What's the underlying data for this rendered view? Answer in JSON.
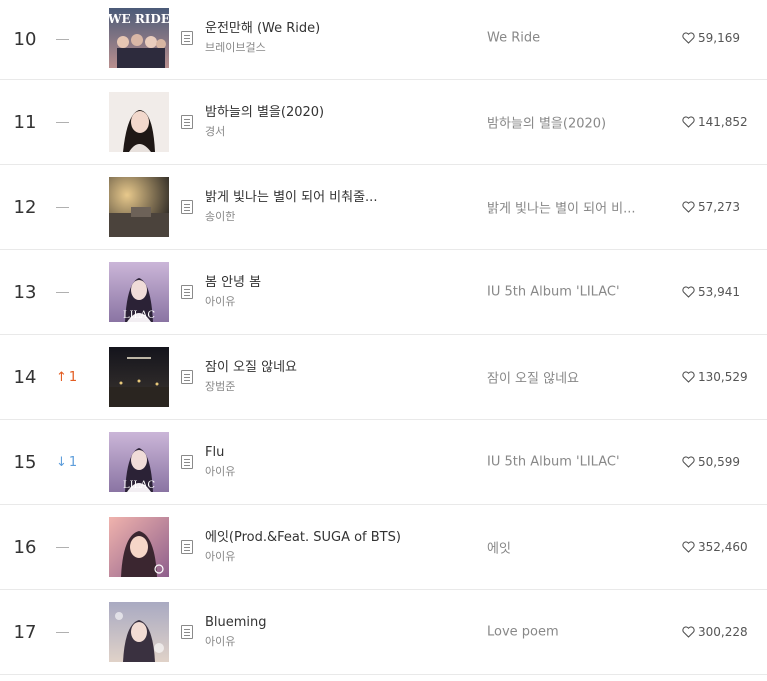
{
  "rows": [
    {
      "rank": "10",
      "change": "same",
      "change_num": "",
      "title": "운전만해 (We Ride)",
      "artist": "브레이브걸스",
      "album": "We Ride",
      "likes": "59,169",
      "cover_text": "WE RIDE",
      "cover_bg": "#5d6d88",
      "cover_bg2": "#c7a8a8"
    },
    {
      "rank": "11",
      "change": "same",
      "change_num": "",
      "title": "밤하늘의 별을(2020)",
      "artist": "경서",
      "album": "밤하늘의 별을(2020)",
      "likes": "141,852",
      "cover_text": "",
      "cover_bg": "#efe9e6",
      "cover_bg2": "#2b2220"
    },
    {
      "rank": "12",
      "change": "same",
      "change_num": "",
      "title": "밝게 빛나는 별이 되어 비춰줄...",
      "artist": "송이한",
      "album": "밝게 빛나는 별이 되어 비...",
      "likes": "57,273",
      "cover_text": "",
      "cover_bg": "#3a3530",
      "cover_bg2": "#c9a874"
    },
    {
      "rank": "13",
      "change": "same",
      "change_num": "",
      "title": "봄 안녕 봄",
      "artist": "아이유",
      "album": "IU 5th Album 'LILAC'",
      "likes": "53,941",
      "cover_text": "LILAC",
      "cover_bg": "#b9a1c6",
      "cover_bg2": "#3e2d52"
    },
    {
      "rank": "14",
      "change": "up",
      "change_num": "1",
      "title": "잠이 오질 않네요",
      "artist": "장범준",
      "album": "잠이 오질 않네요",
      "likes": "130,529",
      "cover_text": "",
      "cover_bg": "#1a1a22",
      "cover_bg2": "#c9b07a"
    },
    {
      "rank": "15",
      "change": "down",
      "change_num": "1",
      "title": "Flu",
      "artist": "아이유",
      "album": "IU 5th Album 'LILAC'",
      "likes": "50,599",
      "cover_text": "LILAC",
      "cover_bg": "#b9a1c6",
      "cover_bg2": "#3e2d52"
    },
    {
      "rank": "16",
      "change": "same",
      "change_num": "",
      "title": "에잇(Prod.&Feat. SUGA of BTS)",
      "artist": "아이유",
      "album": "에잇",
      "likes": "352,460",
      "cover_text": "",
      "cover_bg": "#e9a0a0",
      "cover_bg2": "#6a4a6e"
    },
    {
      "rank": "17",
      "change": "same",
      "change_num": "",
      "title": "Blueming",
      "artist": "아이유",
      "album": "Love poem",
      "likes": "300,228",
      "cover_text": "",
      "cover_bg": "#b7b8c8",
      "cover_bg2": "#d9c9c2"
    }
  ]
}
